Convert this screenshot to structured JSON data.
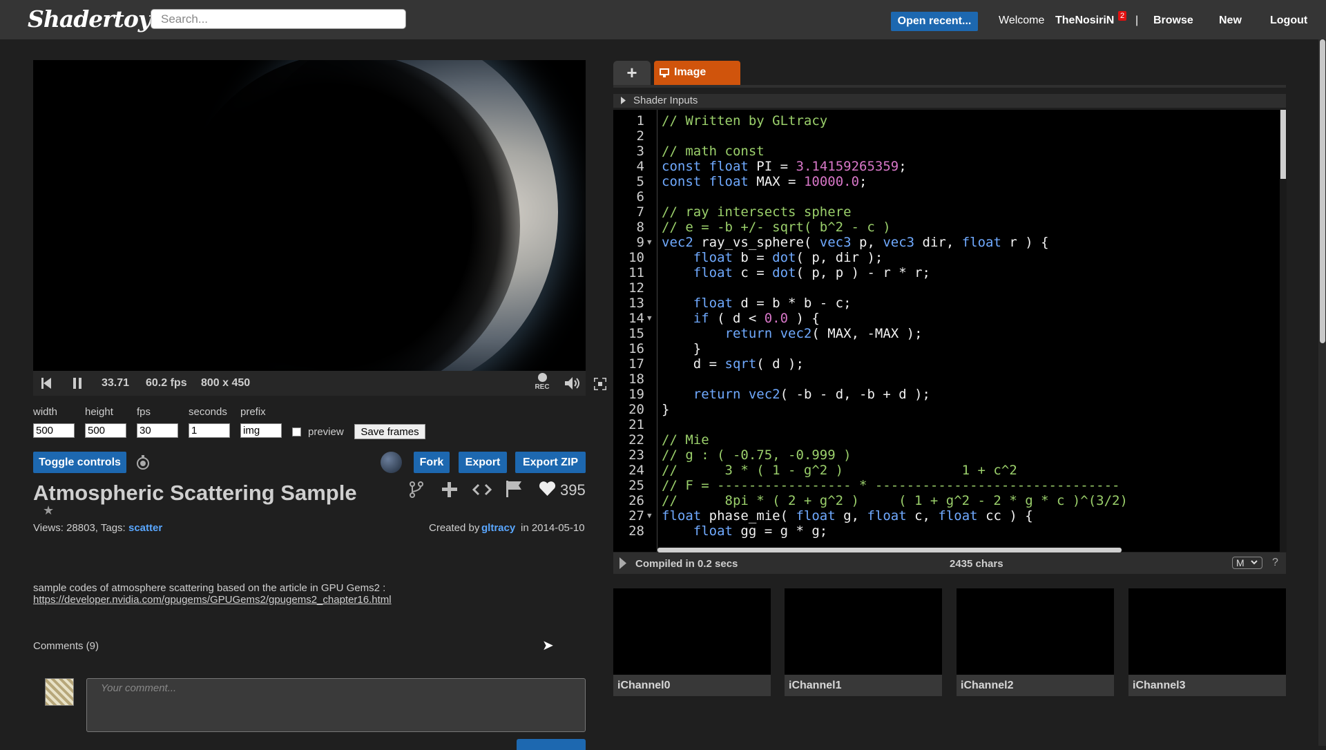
{
  "header": {
    "logo": "Shadertoy",
    "search_placeholder": "Search...",
    "open_recent": "Open recent...",
    "welcome": "Welcome",
    "username": "TheNosiriN",
    "notification_count": "2",
    "separator": "|",
    "browse": "Browse",
    "new": "New",
    "logout": "Logout"
  },
  "player": {
    "time": "33.71",
    "fps": "60.2 fps",
    "resolution": "800 x 450",
    "rec_label": "REC"
  },
  "export_settings": {
    "width_label": "width",
    "width_value": "500",
    "height_label": "height",
    "height_value": "500",
    "fps_label": "fps",
    "fps_value": "30",
    "seconds_label": "seconds",
    "seconds_value": "1",
    "prefix_label": "prefix",
    "prefix_value": "img",
    "preview_label": "preview",
    "save_frames": "Save frames"
  },
  "actions": {
    "toggle_controls": "Toggle controls",
    "fork": "Fork",
    "export": "Export",
    "export_zip": "Export ZIP",
    "likes": "395"
  },
  "shader": {
    "title": "Atmospheric Scattering Sample",
    "views_text": "Views: 28803, Tags:",
    "tag": "scatter",
    "created_by": "Created by",
    "author": "gltracy",
    "date_text": "in 2014-05-10",
    "description": "sample codes of atmosphere scattering based on the article in GPU Gems2 :",
    "description_link": "https://developer.nvidia.com/gpugems/GPUGems2/gpugems2_chapter16.html"
  },
  "comments": {
    "header": "Comments (9)",
    "placeholder": "Your comment..."
  },
  "editor": {
    "add_tab": "+",
    "tab_image": "Image",
    "shader_inputs": "Shader Inputs",
    "compiled": "Compiled in 0.2 secs",
    "chars": "2435 chars",
    "mode": "M",
    "help": "?",
    "lines": [
      "// Written by GLtracy",
      "",
      "// math const",
      "const float PI = 3.14159265359;",
      "const float MAX = 10000.0;",
      "",
      "// ray intersects sphere",
      "// e = -b +/- sqrt( b^2 - c )",
      "vec2 ray_vs_sphere( vec3 p, vec3 dir, float r ) {",
      "    float b = dot( p, dir );",
      "    float c = dot( p, p ) - r * r;",
      "",
      "    float d = b * b - c;",
      "    if ( d < 0.0 ) {",
      "        return vec2( MAX, -MAX );",
      "    }",
      "    d = sqrt( d );",
      "",
      "    return vec2( -b - d, -b + d );",
      "}",
      "",
      "// Mie",
      "// g : ( -0.75, -0.999 )",
      "//      3 * ( 1 - g^2 )               1 + c^2",
      "// F = ----------------- * -------------------------------",
      "//      8pi * ( 2 + g^2 )     ( 1 + g^2 - 2 * g * c )^(3/2)",
      "float phase_mie( float g, float c, float cc ) {",
      "    float gg = g * g;"
    ]
  },
  "channels": [
    "iChannel0",
    "iChannel1",
    "iChannel2",
    "iChannel3"
  ]
}
